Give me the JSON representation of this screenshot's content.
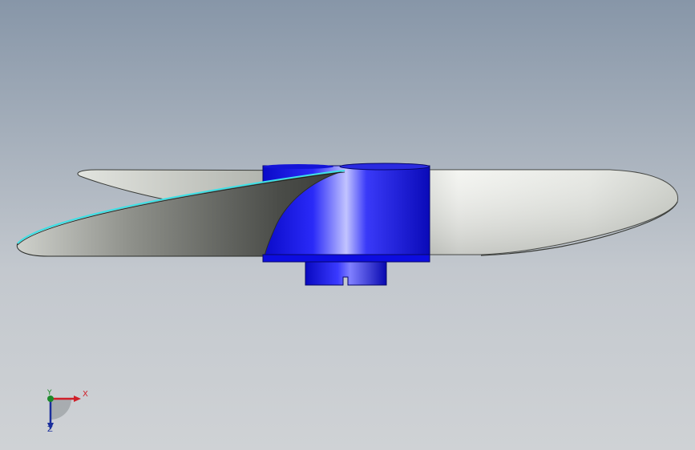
{
  "viewport": {
    "background_top": "#8796a8",
    "background_bottom": "#cfd2d5"
  },
  "model": {
    "part": "propeller",
    "hub_color": "#1010f0",
    "blade_color": "#d8dad6",
    "edge_highlight_color": "#3ee0e6"
  },
  "triad": {
    "x_label": "X",
    "y_label": "Y",
    "z_label": "Z",
    "x_color": "#d0202a",
    "y_color": "#1c8a2a",
    "z_color": "#1a2e9c"
  }
}
